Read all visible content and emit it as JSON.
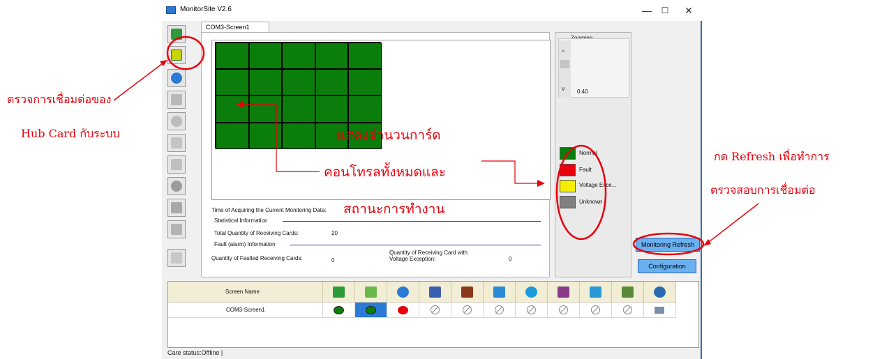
{
  "window": {
    "title": "MonitorSite V2.6",
    "minimize": "—",
    "maximize": "☐",
    "close": "✕"
  },
  "tab": {
    "label": "COM3-Screen1"
  },
  "zoom": {
    "label": "Zooming",
    "value": "0.40",
    "up": "^",
    "down": "v"
  },
  "legend": [
    {
      "label": "Normal",
      "color": "#0a7d0a"
    },
    {
      "label": "Fault",
      "color": "#e8000c"
    },
    {
      "label": "Voltage Exce...",
      "color": "#f5ee00"
    },
    {
      "label": "Unknown",
      "color": "#808080"
    }
  ],
  "grid": {
    "rows": 4,
    "cols": 5,
    "color": "#0a7d0a"
  },
  "info": {
    "time_label": "Time of Acquiring the Current Monitoring Data:",
    "stat_header": "Statistical Information",
    "total_label": "Total Quantity of Receiving Cards:",
    "total_value": "20",
    "fault_header": "Fault (alarm) Information",
    "faulted_label": "Quantity of Faulted Receiving Cards:",
    "faulted_value": "0",
    "voltage_label_1": "Quantity of Receiving Card with",
    "voltage_label_2": "Voltage Exception:",
    "voltage_value": "0"
  },
  "buttons": {
    "refresh": "Monitoring Refresh",
    "configuration": "Configuration"
  },
  "table": {
    "header_name": "Screen Name",
    "row_name": "COM3-Screen1",
    "status_icons": [
      "receiving-card-icon",
      "hub-card-icon",
      "temperature-icon",
      "cabinet-door-icon",
      "smoke-icon",
      "fan-icon",
      "voltage-icon",
      "module-icon",
      "power-icon",
      "monitor-card-icon",
      "network-icon"
    ],
    "row_status": [
      "green",
      "green-selected",
      "red",
      "disabled",
      "disabled",
      "disabled",
      "disabled",
      "disabled",
      "disabled",
      "disabled",
      "monitor"
    ]
  },
  "status_bar": "Care status:Offline  |",
  "annotations": {
    "left_line1": "ตรวจการเชื่อมต่อของ",
    "left_line2": "Hub Card  กับระบบ",
    "center_line1": "แสดงจำนวนการ์ด",
    "center_line2": "คอนโทรลทั้งหมดและ",
    "center_line3": "สถานะการทำงาน",
    "right_line1": "กด Refresh เพื่อทำการ",
    "right_line2": "ตรวจสอบการเชื่อมต่อ"
  },
  "colors": {
    "annotation": "#e8000c",
    "normal": "#0a7d0a",
    "button": "#6ab0f0"
  }
}
